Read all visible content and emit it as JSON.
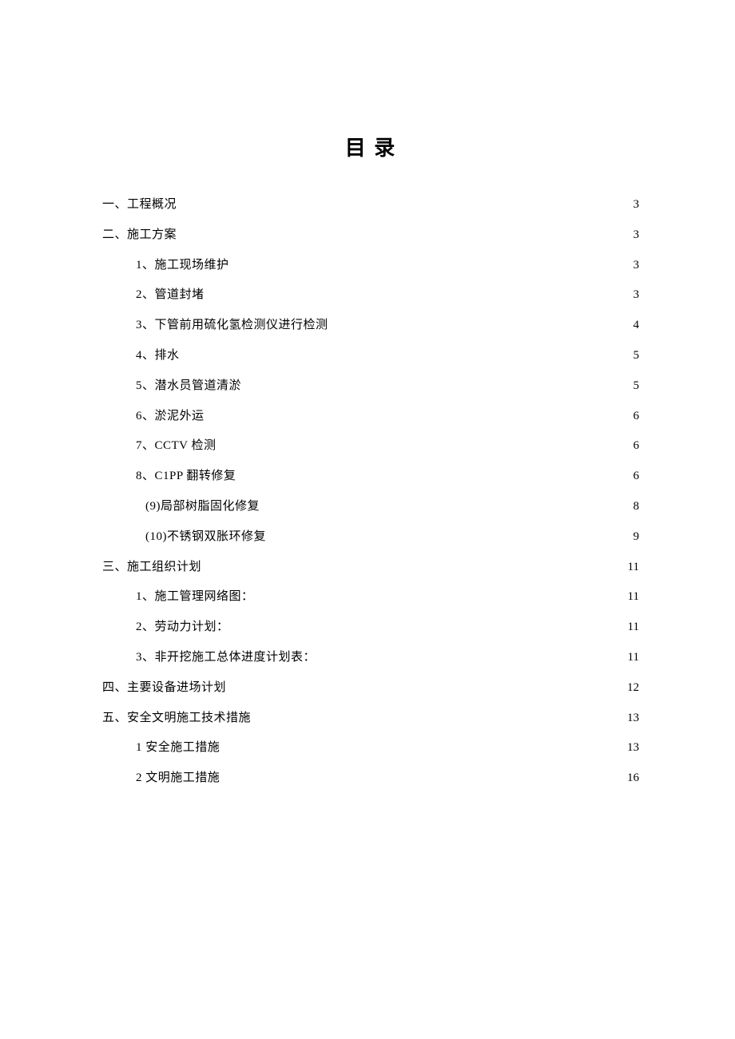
{
  "title": "目 录",
  "toc": [
    {
      "level": 0,
      "label": "一、工程概况",
      "page": "3"
    },
    {
      "level": 0,
      "label": "二、施工方案",
      "page": "3"
    },
    {
      "level": 1,
      "label": "1、施工现场维护",
      "page": "3"
    },
    {
      "level": 1,
      "label": "2、管道封堵",
      "page": "3"
    },
    {
      "level": 1,
      "label": "3、下管前用硫化氢检测仪进行检测",
      "page": "4"
    },
    {
      "level": 1,
      "label": "4、排水",
      "page": "5"
    },
    {
      "level": 1,
      "label": "5、潜水员管道清淤",
      "page": "5"
    },
    {
      "level": 1,
      "label": "6、淤泥外运",
      "page": "6"
    },
    {
      "level": 1,
      "label": "7、CCTV 检测",
      "page": "6"
    },
    {
      "level": 1,
      "label": "8、C1PP 翻转修复",
      "page": "6"
    },
    {
      "level": 2,
      "label": "(9)局部树脂固化修复 ",
      "page": "8"
    },
    {
      "level": 2,
      "label": "(10)不锈钢双胀环修复 ",
      "page": "9"
    },
    {
      "level": 0,
      "label": "三、施工组织计划",
      "page": "11"
    },
    {
      "level": 1,
      "label": "1、施工管理网络图：",
      "page": "11"
    },
    {
      "level": 1,
      "label": "2、劳动力计划：",
      "page": "11"
    },
    {
      "level": 1,
      "label": "3、非开挖施工总体进度计划表：",
      "page": "11"
    },
    {
      "level": 0,
      "label": "四、主要设备进场计划",
      "page": "12"
    },
    {
      "level": 0,
      "label": "五、安全文明施工技术措施",
      "page": "13"
    },
    {
      "level": 1,
      "label": "1 安全施工措施 ",
      "page": "13"
    },
    {
      "level": 1,
      "label": "2 文明施工措施 ",
      "page": "16"
    }
  ]
}
